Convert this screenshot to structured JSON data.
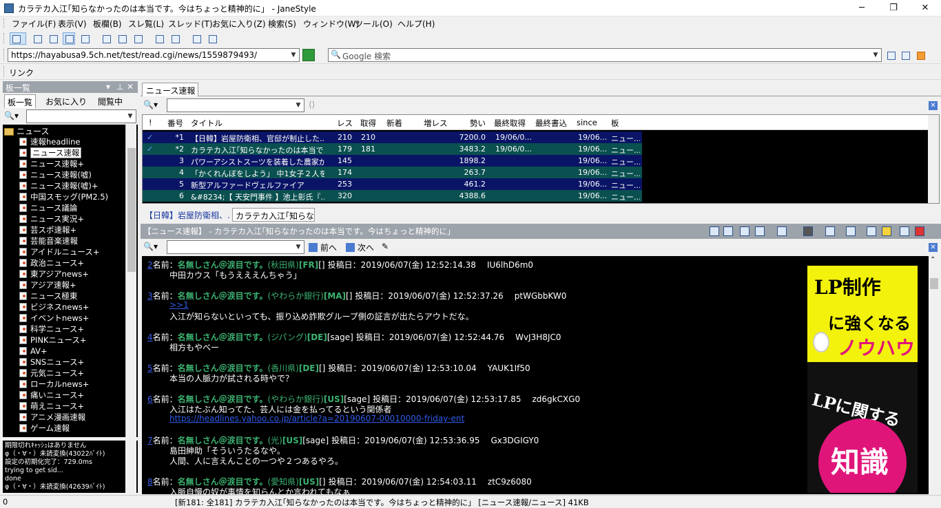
{
  "window": {
    "title": "カラテカ入江｢知らなかったのは本当です。今はちょっと精神的に」 - JaneStyle",
    "min": "─",
    "max": "❐",
    "close": "✕"
  },
  "menu": [
    "ファイル(F)",
    "表示(V)",
    "板欄(B)",
    "スレ覧(L)",
    "スレッド(T)",
    "お気に入り(Z)",
    "検索(S)",
    "ウィンドウ(W)",
    "ツール(O)",
    "ヘルプ(H)"
  ],
  "address": {
    "url": "https://hayabusa9.5ch.net/test/read.cgi/news/1559879493/",
    "search_placeholder": "Google 検索"
  },
  "linkbar": {
    "label": "リンク"
  },
  "board": {
    "header": "板一覧",
    "tabs": [
      "板一覧",
      "お気に入り",
      "閲覧中"
    ],
    "folder": "ニュース",
    "items": [
      "速報headline",
      "ニュース速報",
      "ニュース速報+",
      "ニュース速報(嘘)",
      "ニュース速報(嘘)+",
      "中国スモッグ(PM2.5)",
      "ニュース議論",
      "ニュース実況+",
      "芸スポ速報+",
      "芸能音楽速報",
      "アイドルニュース+",
      "政治ニュース+",
      "東アジアnews+",
      "アジア速報+",
      "ニュース極東",
      "ビジネスnews+",
      "イベントnews+",
      "科学ニュース+",
      "PINKニュース+",
      "AV+",
      "SNSニュース+",
      "元気ニュース+",
      "ローカルnews+",
      "痛いニュース+",
      "萌えニュース+",
      "アニメ漫画速報",
      "ゲーム速報"
    ],
    "selected_index": 1
  },
  "log": [
    "期限切れｷｬｯｼｭはありません",
    "φ（・∀・）未読変換(43022ﾊﾞｲﾄ)",
    "設定の初期化完了：729.0ms",
    "trying to get sid...",
    "done",
    "φ（・∀・）未読変換(42639ﾊﾞｲﾄ)"
  ],
  "thread_list": {
    "tab": "ニュース速報",
    "columns": [
      "!",
      "番号",
      "タイトル",
      "レス",
      "取得",
      "新着",
      "増レス",
      "勢い",
      "最終取得",
      "最終書込",
      "since",
      "板"
    ],
    "rows": [
      {
        "mark": "✓",
        "no": "*1",
        "title": "【日韓】岩屋防衛相、官邸が制止した...",
        "res": "210",
        "got": "210",
        "new": "",
        "inc": "",
        "speed": "7200.0",
        "last": "19/06/0...",
        "since": "19/06...",
        "board": "ニュー..."
      },
      {
        "mark": "✓",
        "no": "*2",
        "title": "カラテカ入江｢知らなかったのは本当で...",
        "res": "179",
        "got": "181",
        "new": "",
        "inc": "",
        "speed": "3483.2",
        "last": "19/06/0...",
        "since": "19/06...",
        "board": "ニュー..."
      },
      {
        "mark": "",
        "no": "3",
        "title": "パワーアシストスーツを装着した農家が...",
        "res": "145",
        "got": "",
        "new": "",
        "inc": "",
        "speed": "1898.2",
        "last": "",
        "since": "19/06...",
        "board": "ニュー..."
      },
      {
        "mark": "",
        "no": "4",
        "title": "「かくれんぼをしよう」 中1女子２人を...",
        "res": "174",
        "got": "",
        "new": "",
        "inc": "",
        "speed": "263.7",
        "last": "",
        "since": "19/06...",
        "board": "ニュー..."
      },
      {
        "mark": "",
        "no": "5",
        "title": "新型アルファードヴェルファイア",
        "res": "253",
        "got": "",
        "new": "",
        "inc": "",
        "speed": "461.2",
        "last": "",
        "since": "19/06...",
        "board": "ニュー..."
      },
      {
        "mark": "",
        "no": "6",
        "title": "&#8234;【 天安門事件 】池上彰氏『...",
        "res": "320",
        "got": "",
        "new": "",
        "inc": "",
        "speed": "4388.6",
        "last": "",
        "since": "19/06...",
        "board": "ニュー..."
      }
    ]
  },
  "open_threads": [
    "【日韓】岩屋防衛相、...",
    "カラテカ入江｢知らな..."
  ],
  "thread_header": "【ニュース速報】 - カラテカ入江｢知らなかったのは本当です。今はちょっと精神的に」",
  "nav": {
    "prev": "前へ",
    "next": "次へ"
  },
  "posts": [
    {
      "num": "2",
      "label": "名前：",
      "name": "名無しさん＠涙目です。",
      "loc": "(秋田県)",
      "flag": "[FR]",
      "mail": "[]",
      "date": "投稿日：2019/06/07(金) 12:52:14.38",
      "id": "IU6lhD6m0",
      "lines": [
        "中田カウス「もうえええんちゃう」"
      ]
    },
    {
      "num": "3",
      "label": "名前：",
      "name": "名無しさん＠涙目です。",
      "loc": "(やわらか銀行)",
      "flag": "[MA]",
      "mail": "[]",
      "date": "投稿日：2019/06/07(金) 12:52:37.26",
      "id": "ptWGbbKW0",
      "anchor": ">>1",
      "lines": [
        "入江が知らないといっても、振り込め詐欺グループ側の証言が出たらアウトだな。"
      ]
    },
    {
      "num": "4",
      "label": "名前：",
      "name": "名無しさん＠涙目です。",
      "loc": "(ジパング)",
      "flag": "[DE]",
      "mail": "[sage]",
      "date": "投稿日：2019/06/07(金) 12:52:44.76",
      "id": "WvJ3H8JC0",
      "lines": [
        "相方もやべー"
      ]
    },
    {
      "num": "5",
      "label": "名前：",
      "name": "名無しさん＠涙目です。",
      "loc": "(香川県)",
      "flag": "[DE]",
      "mail": "[]",
      "date": "投稿日：2019/06/07(金) 12:53:10.04",
      "id": "YAUK1If50",
      "lines": [
        "本当の人脈力が試される時やで？"
      ]
    },
    {
      "num": "6",
      "label": "名前：",
      "name": "名無しさん＠涙目です。",
      "loc": "(やわらか銀行)",
      "flag": "[US]",
      "mail": "[sage]",
      "date": "投稿日：2019/06/07(金) 12:53:17.85",
      "id": "zd6gkCXG0",
      "lines": [
        "入江はたぶん知ってた、芸人には金を払ってるという関係者"
      ],
      "link": "https://headlines.yahoo.co.jp/article?a=20190607-00010000-friday-ent"
    },
    {
      "num": "7",
      "label": "名前：",
      "name": "名無しさん＠涙目です。",
      "loc": "(光)",
      "flag": "[US]",
      "mail": "[sage]",
      "date": "投稿日：2019/06/07(金) 12:53:36.95",
      "id": "Gx3DGIGY0",
      "lines": [
        "島田紳助「そういうたるなや。",
        "人間、人に言えんことの一つや２つあるやろ。"
      ]
    },
    {
      "num": "8",
      "label": "名前：",
      "name": "名無しさん＠涙目です。",
      "loc": "(愛知県)",
      "flag": "[US]",
      "mail": "[]",
      "date": "投稿日：2019/06/07(金) 12:54:03.11",
      "id": "ztC9z6080",
      "lines": [
        "入脈自慢の奴が事情を知らんとか言われてもなぁ"
      ]
    }
  ],
  "ad": {
    "line1": "LP制作",
    "line2": "に強くなる",
    "line3": "ノウハウ",
    "line4": "LPに関する",
    "line5": "知識"
  },
  "status": {
    "left": "0",
    "main": "[新181: 全181] カラテカ入江｢知らなかったのは本当です。今はちょっと精神的に」 [ニュース速報/ニュース] 41KB"
  },
  "colors": {
    "row_a": "#0a1466",
    "row_b": "#0a5050",
    "name_green": "#3cb371",
    "link_blue": "#2f5be8"
  }
}
